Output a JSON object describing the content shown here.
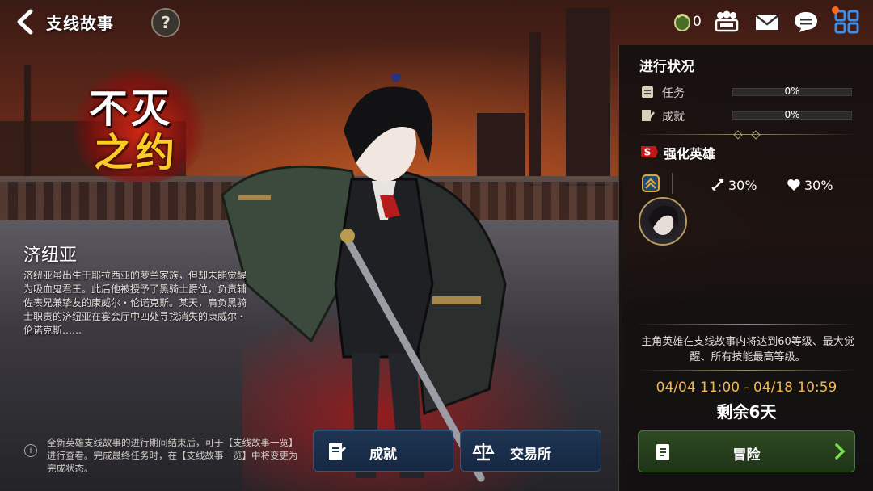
{
  "header": {
    "title": "支线故事",
    "help_label": "?",
    "currency_value": "0"
  },
  "logo": {
    "line1": "不灭",
    "line2": "之约"
  },
  "hero": {
    "name": "济纽亚",
    "description": "济纽亚虽出生于耶拉西亚的萝兰家族，但却未能觉醒为吸血鬼君王。此后他被授予了黑骑士爵位，负责辅佐表兄兼挚友的康威尔・伦诺克斯。某天，肩负黑骑士职责的济纽亚在宴会厅中四处寻找消失的康威尔・伦诺克斯……"
  },
  "notice": {
    "icon": "i",
    "text": "全新英雄支线故事的进行期间结束后，可于【支线故事一览】进行查看。完成最终任务时，在【支线故事一览】中将变更为完成状态。"
  },
  "buttons": {
    "achievement": "成就",
    "exchange": "交易所",
    "adventure": "冒险"
  },
  "progress": {
    "title": "进行状况",
    "rows": [
      {
        "label": "任务",
        "value": "0%",
        "fraction": 0
      },
      {
        "label": "成就",
        "value": "0%",
        "fraction": 0
      }
    ]
  },
  "enhance": {
    "title": "强化英雄",
    "badge": "S",
    "attack": "30%",
    "health": "30%",
    "description": "主角英雄在支线故事内将达到60等级、最大觉醒、所有技能最高等级。",
    "period": "04/04 11:00 - 04/18 10:59",
    "remaining": "剩余6天"
  },
  "colors": {
    "accent_gold": "#f0b84a",
    "button_blue": "#1e3552",
    "button_green": "#2f4a22",
    "notification": "#ff6a1a"
  }
}
